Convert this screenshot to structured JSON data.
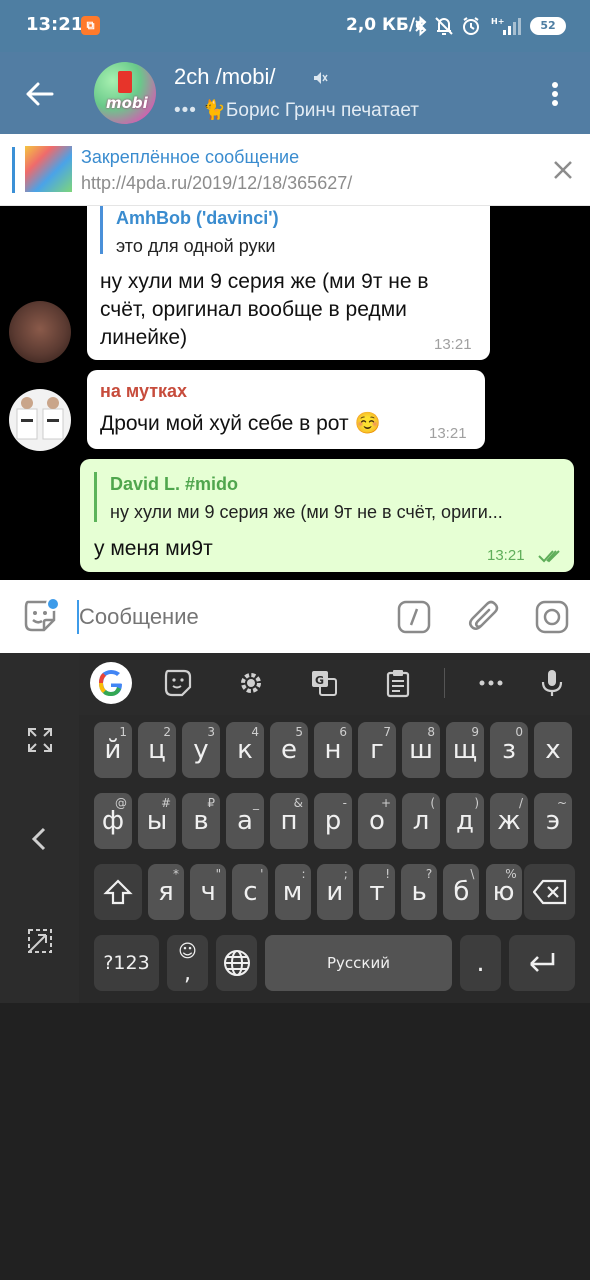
{
  "status_bar": {
    "time": "13:21",
    "notification_badge": "2ch",
    "speed": "2,0 КБ/с",
    "network": "H+",
    "battery": "52"
  },
  "header": {
    "title": "2ch /mobi/",
    "avatar_text": "mobi",
    "typing_dots": "•••",
    "typing_emoji": "🐈",
    "typing_status": "Борис Гринч печатает"
  },
  "pinned": {
    "title": "Закреплённое сообщение",
    "text": "http://4pda.ru/2019/12/18/365627/"
  },
  "messages": [
    {
      "quote_name": "AmhBob ('davinci')",
      "quote_text": "это для одной руки",
      "lines": [
        "ну хули ми 9 серия же (ми 9т не в",
        "счёт, оригинал вообще в редми",
        "линейке)"
      ],
      "time": "13:21"
    },
    {
      "sender": "на мутках",
      "text": "Дрочи мой хуй себе в рот ☺️",
      "time": "13:21"
    },
    {
      "quote_name": "David L. #mido",
      "quote_text": "ну хули ми 9 серия же (ми 9т не в счёт, ориги...",
      "text": "у меня ми9т",
      "time": "13:21"
    }
  ],
  "input": {
    "placeholder": "Сообщение"
  },
  "keyboard": {
    "row1": [
      {
        "k": "й",
        "h": "1"
      },
      {
        "k": "ц",
        "h": "2"
      },
      {
        "k": "у",
        "h": "3"
      },
      {
        "k": "к",
        "h": "4"
      },
      {
        "k": "е",
        "h": "5"
      },
      {
        "k": "н",
        "h": "6"
      },
      {
        "k": "г",
        "h": "7"
      },
      {
        "k": "ш",
        "h": "8"
      },
      {
        "k": "щ",
        "h": "9"
      },
      {
        "k": "з",
        "h": "0"
      },
      {
        "k": "х",
        "h": ""
      }
    ],
    "row2": [
      {
        "k": "ф",
        "h": "@"
      },
      {
        "k": "ы",
        "h": "#"
      },
      {
        "k": "в",
        "h": "₽"
      },
      {
        "k": "а",
        "h": "_"
      },
      {
        "k": "п",
        "h": "&"
      },
      {
        "k": "р",
        "h": "-"
      },
      {
        "k": "о",
        "h": "+"
      },
      {
        "k": "л",
        "h": "("
      },
      {
        "k": "д",
        "h": ")"
      },
      {
        "k": "ж",
        "h": "/"
      },
      {
        "k": "э",
        "h": "~"
      }
    ],
    "row3": [
      {
        "k": "я",
        "h": "*"
      },
      {
        "k": "ч",
        "h": "\""
      },
      {
        "k": "с",
        "h": "'"
      },
      {
        "k": "м",
        "h": ":"
      },
      {
        "k": "и",
        "h": ";"
      },
      {
        "k": "т",
        "h": "!"
      },
      {
        "k": "ь",
        "h": "?"
      },
      {
        "k": "б",
        "h": "\\"
      },
      {
        "k": "ю",
        "h": "%"
      }
    ],
    "sym_label": "?123",
    "emoji_hint": "☺",
    "comma": ",",
    "space_label": "Русский",
    "period": "."
  }
}
